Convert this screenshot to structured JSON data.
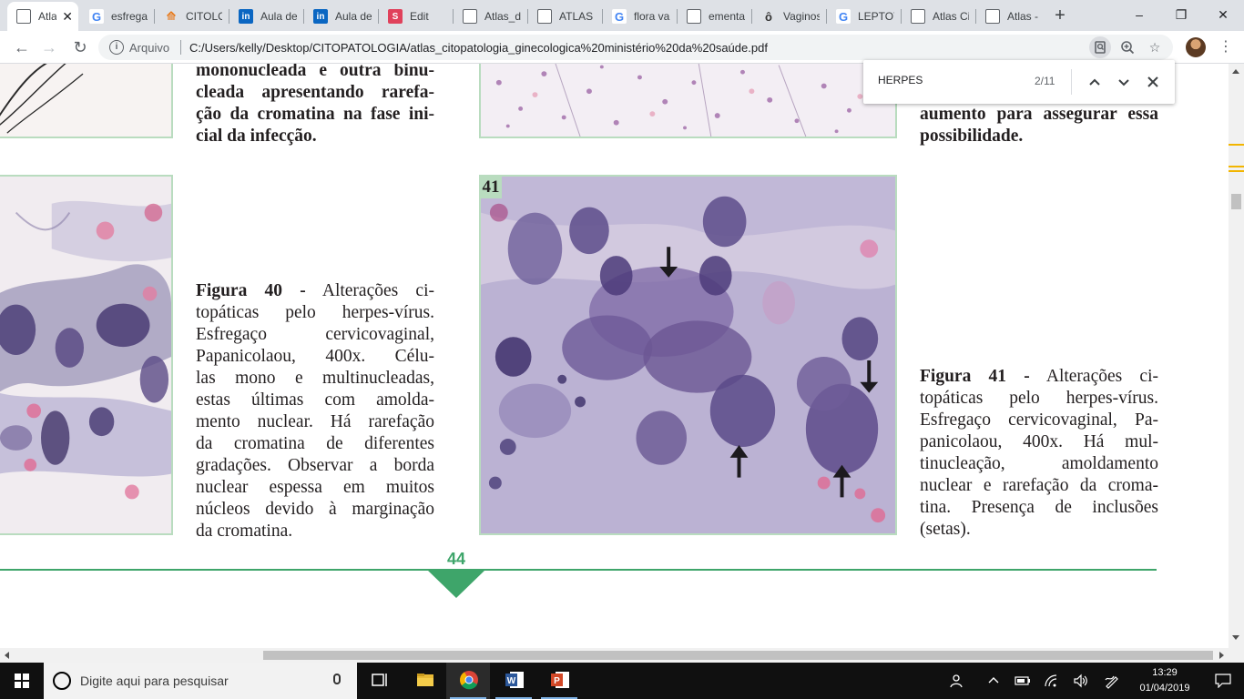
{
  "browser": {
    "tabs": [
      {
        "title": "Atla",
        "favicon": "pdf-icon",
        "active": true
      },
      {
        "title": "esfrega",
        "favicon": "google-icon"
      },
      {
        "title": "CITOLO",
        "favicon": "course-icon"
      },
      {
        "title": "Aula de",
        "favicon": "linkedin-icon"
      },
      {
        "title": "Aula de",
        "favicon": "linkedin-icon"
      },
      {
        "title": "Edit",
        "favicon": "edit-app-icon"
      },
      {
        "title": "Atlas_d",
        "favicon": "doc-icon"
      },
      {
        "title": "ATLAS D",
        "favicon": "doc-icon"
      },
      {
        "title": "flora va",
        "favicon": "google-icon"
      },
      {
        "title": "ementa",
        "favicon": "doc-icon"
      },
      {
        "title": "Vaginos",
        "favicon": "ovaloop-icon"
      },
      {
        "title": "LEPTOT",
        "favicon": "google-icon"
      },
      {
        "title": "Atlas Ci",
        "favicon": "doc-icon"
      },
      {
        "title": "Atlas - f",
        "favicon": "doc-icon"
      }
    ],
    "new_tab": "+",
    "window_controls": {
      "minimize": "–",
      "restore": "❐",
      "close": "✕"
    },
    "toolbar": {
      "back": "←",
      "forward": "→",
      "reload": "↻",
      "scheme_label": "Arquivo",
      "url": "C:/Users/kelly/Desktop/CITOPATOLOGIA/atlas_citopatologia_ginecologica%20ministério%20da%20saúde.pdf"
    }
  },
  "find_bar": {
    "query": "HERPES",
    "count": "2/11",
    "prev": "⌃",
    "next": "⌄",
    "close": "✕"
  },
  "document": {
    "top_left_caption_lines": [
      "mononucleada e outra binu-",
      "cleada apresentando rarefa-",
      "ção da cromatina na fase ini-",
      "cial da infecção."
    ],
    "top_right_caption_lines": [
      "aumento para assegurar essa",
      "possibilidade."
    ],
    "figure40": {
      "label": "Figura 40 -",
      "lines": [
        "Alterações ci-",
        "topáticas pelo herpes-vírus.",
        "Esfregaço cervicovaginal,",
        "Papanicolaou, 400x. Célu-",
        "las mono e multinucleadas,",
        "estas últimas com amolda-",
        "mento nuclear. Há rarefação",
        "da cromatina de diferentes",
        "gradações. Observar a borda",
        "nuclear espessa em muitos",
        "núcleos devido à marginação",
        "da cromatina."
      ]
    },
    "figure41": {
      "number": "41",
      "label": "Figura 41 -",
      "lines": [
        "Alterações ci-",
        "topáticas pelo herpes-vírus.",
        "Esfregaço cervicovaginal, Pa-",
        "panicolaou, 400x. Há mul-",
        "tinucleação, amoldamento",
        "nuclear e rarefação da croma-",
        "tina. Presença de inclusões",
        "(setas)."
      ]
    },
    "page_number": "44",
    "accent_color": "#3ea56a"
  },
  "taskbar": {
    "search_placeholder": "Digite aqui para pesquisar",
    "apps": [
      "task-view-icon",
      "file-explorer-icon",
      "chrome-icon",
      "word-icon",
      "powerpoint-icon"
    ],
    "time": "13:29",
    "date": "01/04/2019"
  }
}
